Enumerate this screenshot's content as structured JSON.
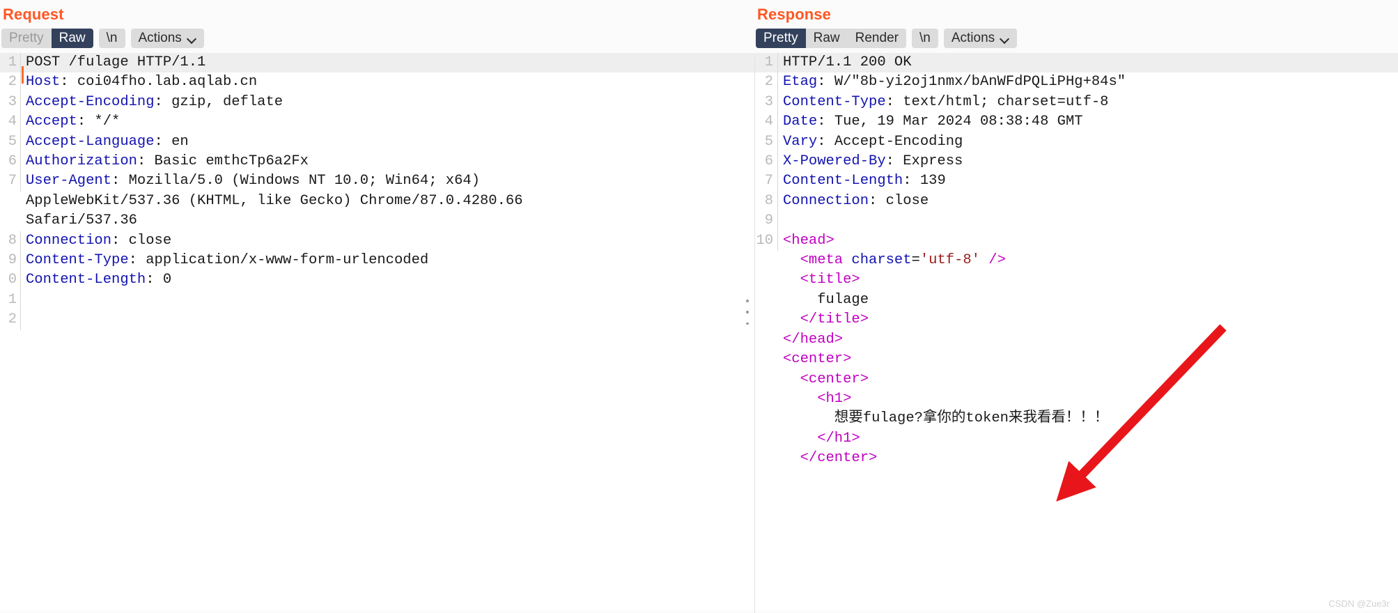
{
  "request": {
    "title": "Request",
    "tabs": [
      {
        "label": "Pretty",
        "active": false,
        "muted": true
      },
      {
        "label": "Raw",
        "active": true,
        "muted": false
      }
    ],
    "newline_button": "\\n",
    "actions_button": "Actions",
    "lines": [
      {
        "num": "1",
        "highlight": true,
        "caret": true,
        "segments": [
          {
            "text": "POST /fulage HTTP/1.1",
            "style": "plain"
          }
        ]
      },
      {
        "num": "2",
        "segments": [
          {
            "text": "Host",
            "style": "hdr"
          },
          {
            "text": ": coi04fho.lab.aqlab.cn",
            "style": "plain"
          }
        ]
      },
      {
        "num": "3",
        "segments": [
          {
            "text": "Accept-Encoding",
            "style": "hdr"
          },
          {
            "text": ": gzip, deflate",
            "style": "plain"
          }
        ]
      },
      {
        "num": "4",
        "segments": [
          {
            "text": "Accept",
            "style": "hdr"
          },
          {
            "text": ": */*",
            "style": "plain"
          }
        ]
      },
      {
        "num": "5",
        "segments": [
          {
            "text": "Accept-Language",
            "style": "hdr"
          },
          {
            "text": ": en",
            "style": "plain"
          }
        ]
      },
      {
        "num": "6",
        "segments": [
          {
            "text": "Authorization",
            "style": "hdr"
          },
          {
            "text": ": Basic emthcTp6a2Fx",
            "style": "plain"
          }
        ]
      },
      {
        "num": "7",
        "segments": [
          {
            "text": "User-Agent",
            "style": "hdr"
          },
          {
            "text": ": Mozilla/5.0 (Windows NT 10.0; Win64; x64)",
            "style": "plain"
          }
        ]
      },
      {
        "num": "",
        "continuation": true,
        "segments": [
          {
            "text": "AppleWebKit/537.36 (KHTML, like Gecko) Chrome/87.0.4280.66",
            "style": "plain"
          }
        ]
      },
      {
        "num": "",
        "continuation": true,
        "segments": [
          {
            "text": "Safari/537.36",
            "style": "plain"
          }
        ]
      },
      {
        "num": "8",
        "segments": [
          {
            "text": "Connection",
            "style": "hdr"
          },
          {
            "text": ": close",
            "style": "plain"
          }
        ]
      },
      {
        "num": "9",
        "segments": [
          {
            "text": "Content-Type",
            "style": "hdr"
          },
          {
            "text": ": application/x-www-form-urlencoded",
            "style": "plain"
          }
        ]
      },
      {
        "num": "0",
        "segments": [
          {
            "text": "Content-Length",
            "style": "hdr"
          },
          {
            "text": ": 0",
            "style": "plain"
          }
        ]
      },
      {
        "num": "1",
        "segments": [
          {
            "text": "",
            "style": "plain"
          }
        ]
      },
      {
        "num": "2",
        "segments": [
          {
            "text": "",
            "style": "plain"
          }
        ]
      }
    ]
  },
  "response": {
    "title": "Response",
    "tabs": [
      {
        "label": "Pretty",
        "active": true,
        "muted": false
      },
      {
        "label": "Raw",
        "active": false,
        "muted": false
      },
      {
        "label": "Render",
        "active": false,
        "muted": false
      }
    ],
    "newline_button": "\\n",
    "actions_button": "Actions",
    "lines": [
      {
        "num": "1",
        "highlight": true,
        "segments": [
          {
            "text": "HTTP/1.1 200 OK",
            "style": "plain"
          }
        ]
      },
      {
        "num": "2",
        "segments": [
          {
            "text": "Etag",
            "style": "hdr"
          },
          {
            "text": ": W/\"8b-yi2oj1nmx/bAnWFdPQLiPHg+84s\"",
            "style": "plain"
          }
        ]
      },
      {
        "num": "3",
        "segments": [
          {
            "text": "Content-Type",
            "style": "hdr"
          },
          {
            "text": ": text/html; charset=utf-8",
            "style": "plain"
          }
        ]
      },
      {
        "num": "4",
        "segments": [
          {
            "text": "Date",
            "style": "hdr"
          },
          {
            "text": ": Tue, 19 Mar 2024 08:38:48 GMT",
            "style": "plain"
          }
        ]
      },
      {
        "num": "5",
        "segments": [
          {
            "text": "Vary",
            "style": "hdr"
          },
          {
            "text": ": Accept-Encoding",
            "style": "plain"
          }
        ]
      },
      {
        "num": "6",
        "segments": [
          {
            "text": "X-Powered-By",
            "style": "hdr"
          },
          {
            "text": ": Express",
            "style": "plain"
          }
        ]
      },
      {
        "num": "7",
        "segments": [
          {
            "text": "Content-Length",
            "style": "hdr"
          },
          {
            "text": ": 139",
            "style": "plain"
          }
        ]
      },
      {
        "num": "8",
        "segments": [
          {
            "text": "Connection",
            "style": "hdr"
          },
          {
            "text": ": close",
            "style": "plain"
          }
        ]
      },
      {
        "num": "9",
        "segments": [
          {
            "text": "",
            "style": "plain"
          }
        ]
      },
      {
        "num": "10",
        "segments": [
          {
            "text": "<head>",
            "style": "tagname"
          }
        ]
      },
      {
        "num": "",
        "continuation": true,
        "segments": [
          {
            "text": "  <meta ",
            "style": "tagname"
          },
          {
            "text": "charset",
            "style": "attr"
          },
          {
            "text": "=",
            "style": "plain"
          },
          {
            "text": "'utf-8'",
            "style": "attrval"
          },
          {
            "text": " />",
            "style": "tagname"
          }
        ]
      },
      {
        "num": "",
        "continuation": true,
        "segments": [
          {
            "text": "  <title>",
            "style": "tagname"
          }
        ]
      },
      {
        "num": "",
        "continuation": true,
        "segments": [
          {
            "text": "    fulage",
            "style": "plain"
          }
        ]
      },
      {
        "num": "",
        "continuation": true,
        "segments": [
          {
            "text": "  </title>",
            "style": "tagname"
          }
        ]
      },
      {
        "num": "",
        "continuation": true,
        "segments": [
          {
            "text": "</head>",
            "style": "tagname"
          }
        ]
      },
      {
        "num": "",
        "continuation": true,
        "segments": [
          {
            "text": "<center>",
            "style": "tagname"
          }
        ]
      },
      {
        "num": "",
        "continuation": true,
        "segments": [
          {
            "text": "  <center>",
            "style": "tagname"
          }
        ]
      },
      {
        "num": "",
        "continuation": true,
        "segments": [
          {
            "text": "    <h1>",
            "style": "tagname"
          }
        ]
      },
      {
        "num": "",
        "continuation": true,
        "segments": [
          {
            "text": "      想要fulage?拿你的token来我看看！！！",
            "style": "plain"
          }
        ]
      },
      {
        "num": "",
        "continuation": true,
        "segments": [
          {
            "text": "    </h1>",
            "style": "tagname"
          }
        ]
      },
      {
        "num": "",
        "continuation": true,
        "segments": [
          {
            "text": "  </center>",
            "style": "tagname"
          }
        ]
      }
    ]
  },
  "annotation": {
    "arrow_color": "#e8161a",
    "arrow_name": "red-pointer-arrow"
  },
  "watermark": "CSDN @Zue3r"
}
